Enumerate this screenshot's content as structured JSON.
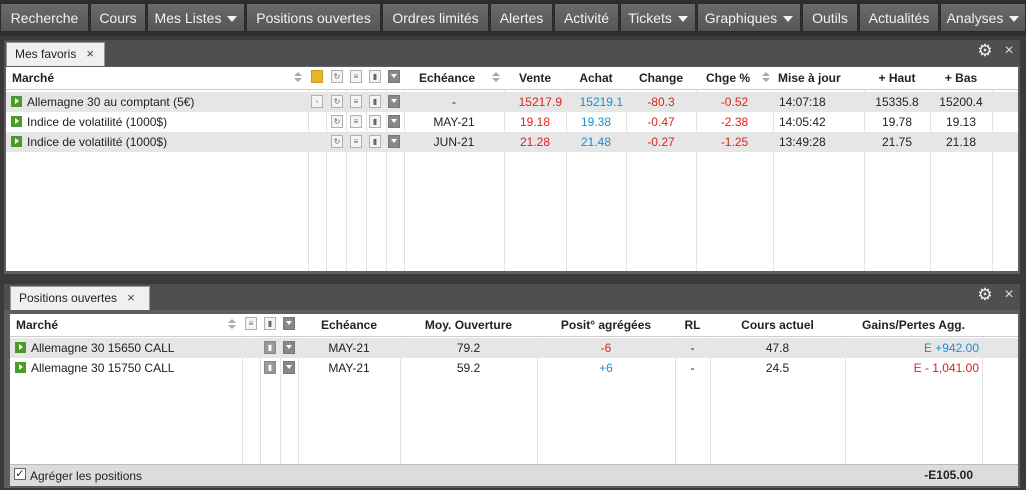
{
  "nav": {
    "items": [
      {
        "label": "Recherche",
        "caret": false
      },
      {
        "label": "Cours",
        "caret": false
      },
      {
        "label": "Mes Listes",
        "caret": true
      },
      {
        "label": "Positions ouvertes",
        "caret": false
      },
      {
        "label": "Ordres limités",
        "caret": false
      },
      {
        "label": "Alertes",
        "caret": false
      },
      {
        "label": "Activité",
        "caret": false
      },
      {
        "label": "Tickets",
        "caret": true
      },
      {
        "label": "Graphiques",
        "caret": true
      },
      {
        "label": "Outils",
        "caret": false
      },
      {
        "label": "Actualités",
        "caret": false
      },
      {
        "label": "Analyses",
        "caret": true
      }
    ]
  },
  "favorites": {
    "tab_label": "Mes favoris",
    "tab_close": "×",
    "gear_icon": "gear-icon",
    "close_icon": "×",
    "headers": {
      "market": "Marché",
      "expiry": "Echéance",
      "sell": "Vente",
      "buy": "Achat",
      "change": "Change",
      "change_pct": "Chge %",
      "updated": "Mise à jour",
      "high": "+ Haut",
      "low": "+ Bas"
    },
    "rows": [
      {
        "market": "Allemagne 30 au comptant (5€)",
        "expiry": "-",
        "sell": "15217.9",
        "buy": "15219.1",
        "change": "-80.3",
        "change_pct": "-0.52",
        "updated": "14:07:18",
        "high": "15335.8",
        "low": "15200.4"
      },
      {
        "market": "Indice de volatilité (1000$)",
        "expiry": "MAY-21",
        "sell": "19.18",
        "buy": "19.38",
        "change": "-0.47",
        "change_pct": "-2.38",
        "updated": "14:05:42",
        "high": "19.78",
        "low": "19.13"
      },
      {
        "market": "Indice de volatilité (1000$)",
        "expiry": "JUN-21",
        "sell": "21.28",
        "buy": "21.48",
        "change": "-0.27",
        "change_pct": "-1.25",
        "updated": "13:49:28",
        "high": "21.75",
        "low": "21.18"
      }
    ]
  },
  "positions": {
    "tab_label": "Positions ouvertes",
    "tab_close": "×",
    "close_icon": "×",
    "headers": {
      "market": "Marché",
      "expiry": "Echéance",
      "avg_open": "Moy. Ouverture",
      "aggregated": "Posit° agrégées",
      "rl": "RL",
      "current": "Cours actuel",
      "pnl": "Gains/Pertes Agg."
    },
    "rows": [
      {
        "market": "Allemagne 30 15650 CALL",
        "expiry": "MAY-21",
        "avg_open": "79.2",
        "aggregated": "-6",
        "aggregated_color": "red",
        "rl": "-",
        "current": "47.8",
        "pnl": "E +942.00",
        "pnl_color": "blue"
      },
      {
        "market": "Allemagne 30 15750 CALL",
        "expiry": "MAY-21",
        "avg_open": "59.2",
        "aggregated": "+6",
        "aggregated_color": "blue",
        "rl": "-",
        "current": "24.5",
        "pnl": "E - 1,041.00",
        "pnl_color": "red"
      }
    ],
    "aggregate_label": "Agréger les positions",
    "aggregate_checked": true,
    "total": "-E105.00"
  },
  "colors": {
    "negative": "#d9251d",
    "positive": "#1a8fd1",
    "buy_icon": "#4a9b2a"
  }
}
